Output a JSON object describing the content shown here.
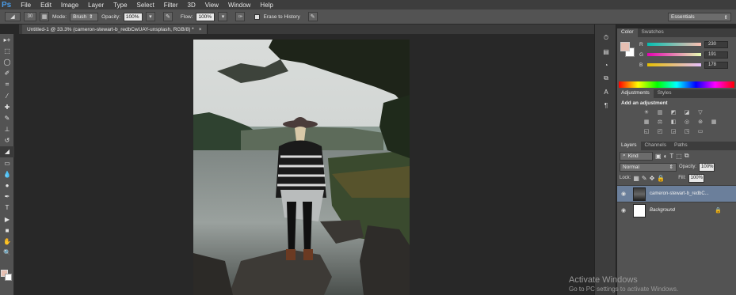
{
  "app": {
    "logo": "Ps"
  },
  "menu": [
    "File",
    "Edit",
    "Image",
    "Layer",
    "Type",
    "Select",
    "Filter",
    "3D",
    "View",
    "Window",
    "Help"
  ],
  "options": {
    "brush_size": "30",
    "mode_label": "Mode:",
    "mode_value": "Brush",
    "opacity_label": "Opacity:",
    "opacity_value": "100%",
    "flow_label": "Flow:",
    "flow_value": "100%",
    "erase_history_label": "Erase to History",
    "workspace": "Essentials"
  },
  "document_tab": {
    "title": "Untitled-1 @ 33.3% (cameron-stewart-b_redbCwUAY-unsplash, RGB/8) *",
    "close": "×"
  },
  "color_panel": {
    "tabs": [
      "Color",
      "Swatches"
    ],
    "channels": [
      {
        "name": "R",
        "value": "230"
      },
      {
        "name": "G",
        "value": "191"
      },
      {
        "name": "B",
        "value": "178"
      }
    ],
    "fg_color": "#e6bfb2",
    "bg_color": "#ffffff"
  },
  "adjustments_panel": {
    "tabs": [
      "Adjustments",
      "Styles"
    ],
    "heading": "Add an adjustment"
  },
  "layers_panel": {
    "tabs": [
      "Layers",
      "Channels",
      "Paths"
    ],
    "filter": "Kind",
    "blend_mode": "Normal",
    "opacity_label": "Opacity:",
    "opacity_value": "100%",
    "lock_label": "Lock:",
    "fill_label": "Fill:",
    "fill_value": "100%",
    "layers": [
      {
        "name": "cameron-stewart-b_redbC...",
        "selected": true
      },
      {
        "name": "Background",
        "selected": false
      }
    ]
  },
  "watermark": {
    "line1": "Activate Windows",
    "line2": "Go to PC settings to activate Windows."
  }
}
